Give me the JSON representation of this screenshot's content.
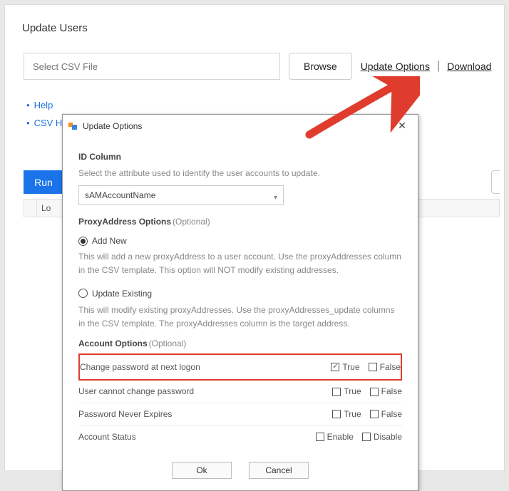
{
  "page": {
    "title": "Update Users"
  },
  "toolbar": {
    "csv_placeholder": "Select CSV File",
    "browse_label": "Browse",
    "update_options_label": "Update Options",
    "download_label": "Download"
  },
  "help": {
    "help_label": "Help",
    "csv_label": "CSV H"
  },
  "run_button_label": "Run",
  "table": {
    "col2_header": "Lo"
  },
  "dialog": {
    "title": "Update Options",
    "id_column": {
      "heading": "ID Column",
      "description": "Select the attribute used to identify the user accounts to update.",
      "select_value": "sAMAccountName"
    },
    "proxy": {
      "heading": "ProxyAddress Options",
      "optional": "(Optional)",
      "add_new_label": "Add New",
      "add_new_desc": "This will add a new proxyAddress to a user account. Use the proxyAddresses column in the CSV template. This option will NOT modify existing addresses.",
      "update_existing_label": "Update Existing",
      "update_existing_desc": "This will modify existing proxyAddresses. Use the proxyAddresses_update columns in the CSV template. The proxyAddresses column is the target address."
    },
    "account": {
      "heading": "Account Options",
      "optional": "(Optional)",
      "rows": [
        {
          "label": "Change password at next logon",
          "opt1": "True",
          "opt2": "False",
          "c1": true,
          "c2": false
        },
        {
          "label": "User cannot change password",
          "opt1": "True",
          "opt2": "False",
          "c1": false,
          "c2": false
        },
        {
          "label": "Password Never Expires",
          "opt1": "True",
          "opt2": "False",
          "c1": false,
          "c2": false
        },
        {
          "label": "Account Status",
          "opt1": "Enable",
          "opt2": "Disable",
          "c1": false,
          "c2": false
        }
      ]
    },
    "ok_label": "Ok",
    "cancel_label": "Cancel"
  },
  "colors": {
    "highlight": "#e03c2e",
    "arrow": "#e03c2e"
  }
}
